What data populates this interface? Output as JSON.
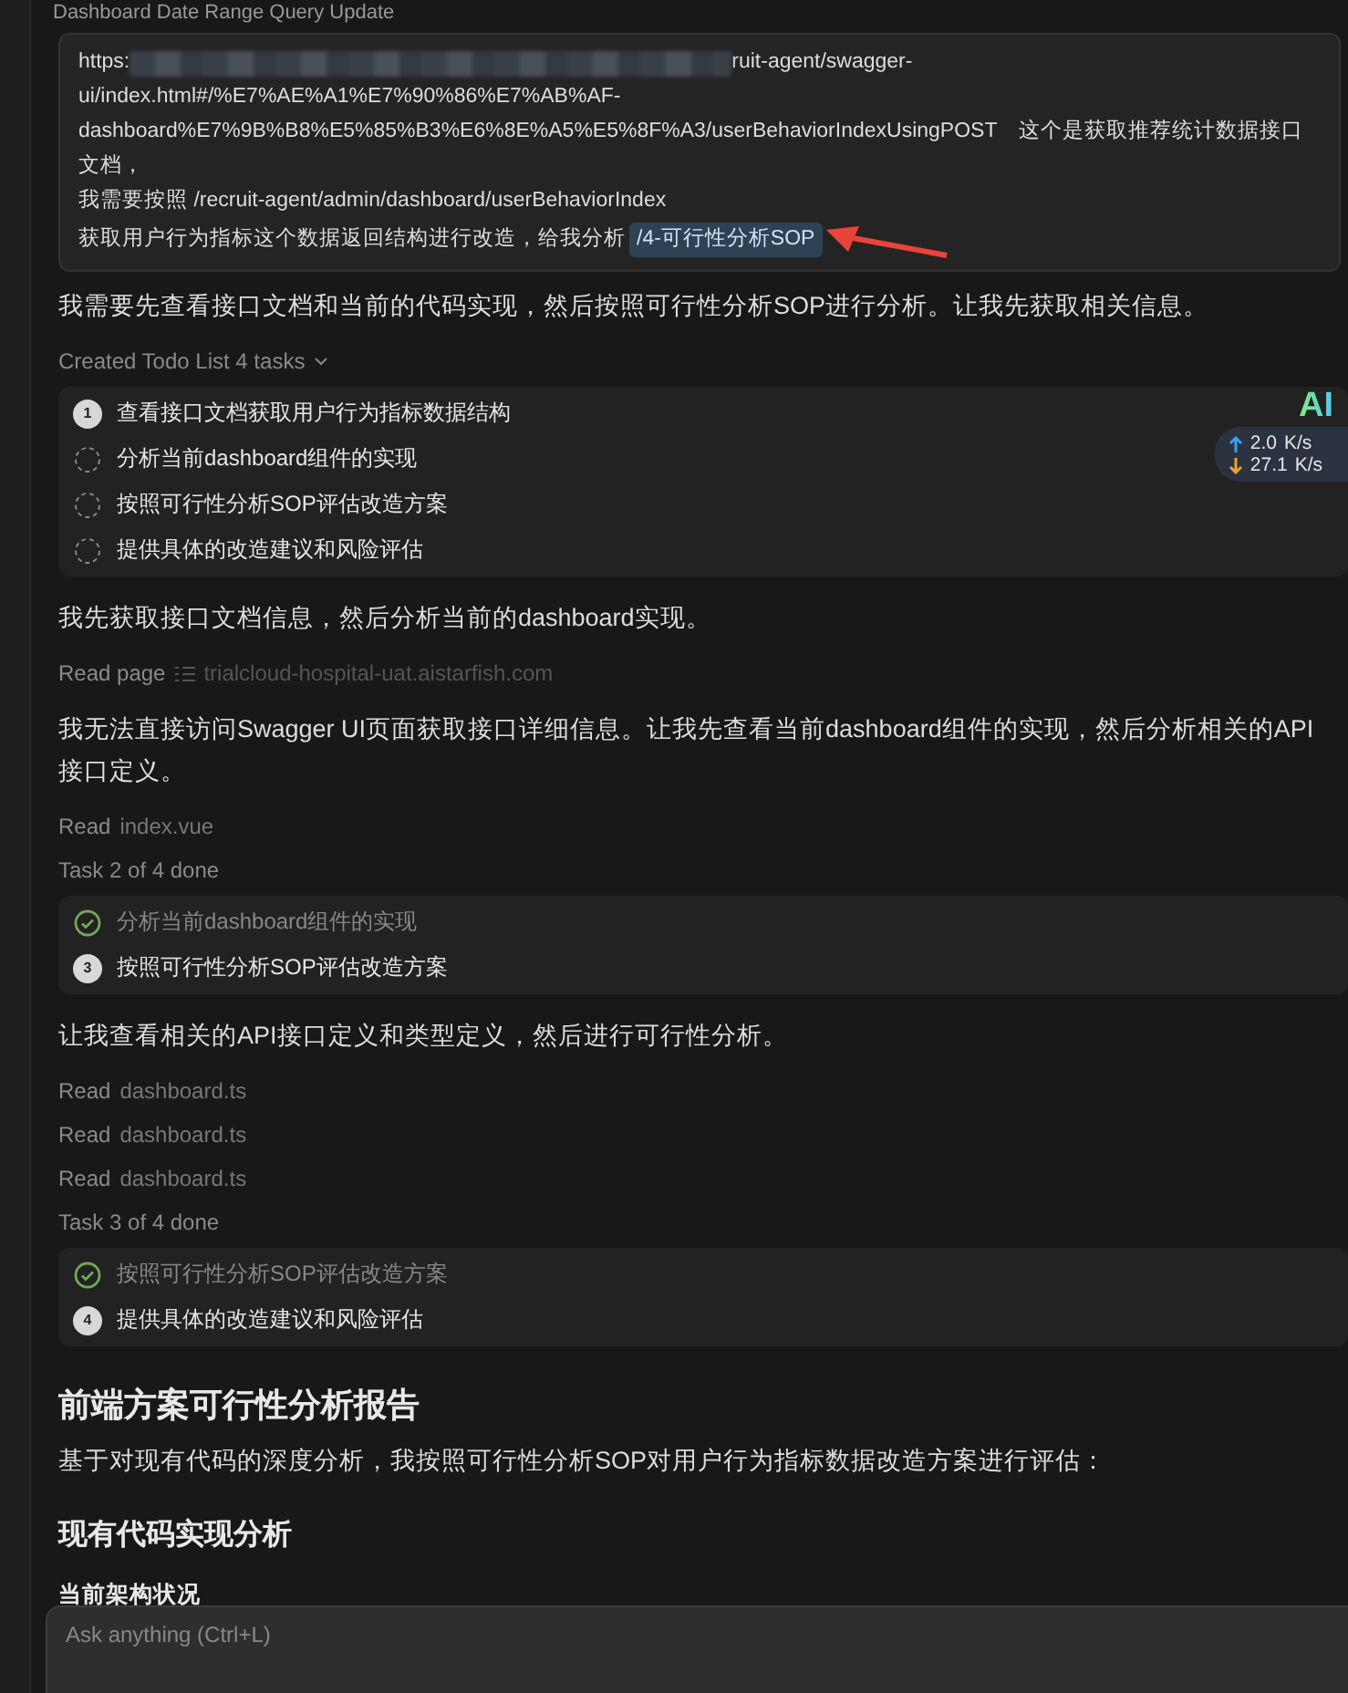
{
  "header": {
    "title": "Dashboard Date Range Query Update"
  },
  "user_message": {
    "lines": [
      {
        "kind": "redacted",
        "before": "https:",
        "after": "ruit-agent/swagger-"
      },
      {
        "kind": "text",
        "text": "ui/index.html#/%E7%AE%A1%E7%90%86%E7%AB%AF-"
      },
      {
        "kind": "text",
        "text": "dashboard%E7%9B%B8%E5%85%B3%E6%8E%A5%E5%8F%A3/userBehaviorIndexUsingPOST　这个是获取推荐统计数据接口文档，"
      },
      {
        "kind": "text",
        "text": "我需要按照 /recruit-agent/admin/dashboard/userBehaviorIndex"
      },
      {
        "kind": "chip",
        "text": "获取用户行为指标这个数据返回结构进行改造，给我分析 ",
        "chip": "/4-可行性分析SOP"
      }
    ]
  },
  "blocks": [
    {
      "kind": "paragraph",
      "text": "我需要先查看接口文档和当前的代码实现，然后按照可行性分析SOP进行分析。让我先获取相关信息。"
    },
    {
      "kind": "todo_header",
      "text": "Created Todo List 4 tasks"
    },
    {
      "kind": "todos",
      "items": [
        {
          "kind": "current",
          "number": "1",
          "text": "查看接口文档获取用户行为指标数据结构"
        },
        {
          "kind": "pending",
          "text": "分析当前dashboard组件的实现"
        },
        {
          "kind": "pending",
          "text": "按照可行性分析SOP评估改造方案"
        },
        {
          "kind": "pending",
          "text": "提供具体的改造建议和风险评估"
        }
      ]
    },
    {
      "kind": "paragraph",
      "text": "我先获取接口文档信息，然后分析当前的dashboard实现。"
    },
    {
      "kind": "action_link",
      "verb": "Read page",
      "target": "trialcloud-hospital-uat.aistarfish.com"
    },
    {
      "kind": "paragraph",
      "text": "我无法直接访问Swagger UI页面获取接口详细信息。让我先查看当前dashboard组件的实现，然后分析相关的API接口定义。"
    },
    {
      "kind": "action",
      "verb": "Read",
      "target": "index.vue"
    },
    {
      "kind": "status",
      "text": "Task 2 of 4 done"
    },
    {
      "kind": "todos",
      "items": [
        {
          "kind": "done",
          "text": "分析当前dashboard组件的实现"
        },
        {
          "kind": "current",
          "number": "3",
          "text": "按照可行性分析SOP评估改造方案"
        }
      ]
    },
    {
      "kind": "paragraph",
      "text": "让我查看相关的API接口定义和类型定义，然后进行可行性分析。"
    },
    {
      "kind": "action",
      "verb": "Read",
      "target": "dashboard.ts"
    },
    {
      "kind": "action",
      "verb": "Read",
      "target": "dashboard.ts"
    },
    {
      "kind": "action",
      "verb": "Read",
      "target": "dashboard.ts"
    },
    {
      "kind": "status",
      "text": "Task 3 of 4 done"
    },
    {
      "kind": "todos",
      "items": [
        {
          "kind": "done",
          "text": "按照可行性分析SOP评估改造方案"
        },
        {
          "kind": "current",
          "number": "4",
          "text": "提供具体的改造建议和风险评估"
        }
      ]
    },
    {
      "kind": "h1",
      "text": "前端方案可行性分析报告"
    },
    {
      "kind": "paragraph",
      "text": "基于对现有代码的深度分析，我按照可行性分析SOP对用户行为指标数据改造方案进行评估："
    },
    {
      "kind": "h2",
      "text": "现有代码实现分析"
    },
    {
      "kind": "h3",
      "text": "当前架构状况"
    }
  ],
  "net_widget": {
    "label": "AI",
    "upload": "2.0",
    "upload_unit": "K/s",
    "download": "27.1",
    "download_unit": "K/s"
  },
  "input": {
    "placeholder": "Ask anything (Ctrl+L)"
  }
}
